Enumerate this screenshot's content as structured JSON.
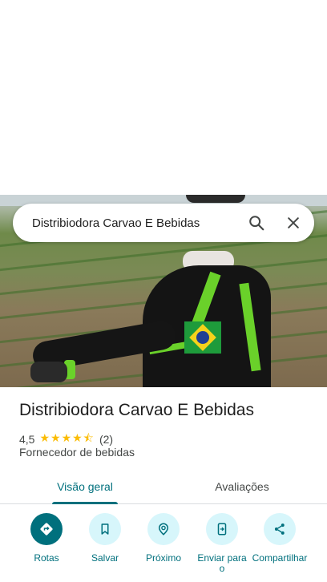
{
  "search": {
    "query": "Distribiodora Carvao E Bebidas"
  },
  "place": {
    "name": "Distribiodora Carvao E Bebidas",
    "rating": "4,5",
    "stars": "★★★★⯪",
    "star_value": 4.5,
    "review_count": "(2)",
    "category": "Fornecedor de bebidas"
  },
  "tabs": [
    {
      "label": "Visão geral",
      "active": true
    },
    {
      "label": "Avaliações",
      "active": false
    }
  ],
  "actions": [
    {
      "label": "Rotas",
      "icon": "directions-icon"
    },
    {
      "label": "Salvar",
      "icon": "bookmark-icon"
    },
    {
      "label": "Próximo",
      "icon": "nearby-icon"
    },
    {
      "label": "Enviar para o",
      "icon": "send-to-phone-icon"
    },
    {
      "label": "Compartilhar",
      "icon": "share-icon"
    }
  ],
  "colors": {
    "accent": "#00707d",
    "chip": "#d7f6fb",
    "star": "#fbbc04"
  }
}
